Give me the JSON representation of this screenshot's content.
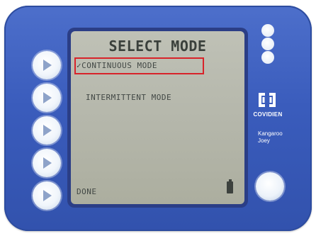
{
  "screen": {
    "title": "SELECT MODE",
    "options": [
      {
        "label": "✓CONTINUOUS MODE",
        "selected": true
      },
      {
        "label": "INTERMITTENT MODE",
        "selected": false
      }
    ],
    "softkey_label": "DONE"
  },
  "brand": {
    "company": "COVIDIEN",
    "product_line1": "Kangaroo",
    "product_line2": "Joey"
  },
  "colors": {
    "housing": "#3a5cbc",
    "lcd": "#b8baae",
    "highlight": "#d8232a"
  },
  "icons": [
    "play-icon",
    "battery-icon",
    "covidien-logo-icon"
  ]
}
